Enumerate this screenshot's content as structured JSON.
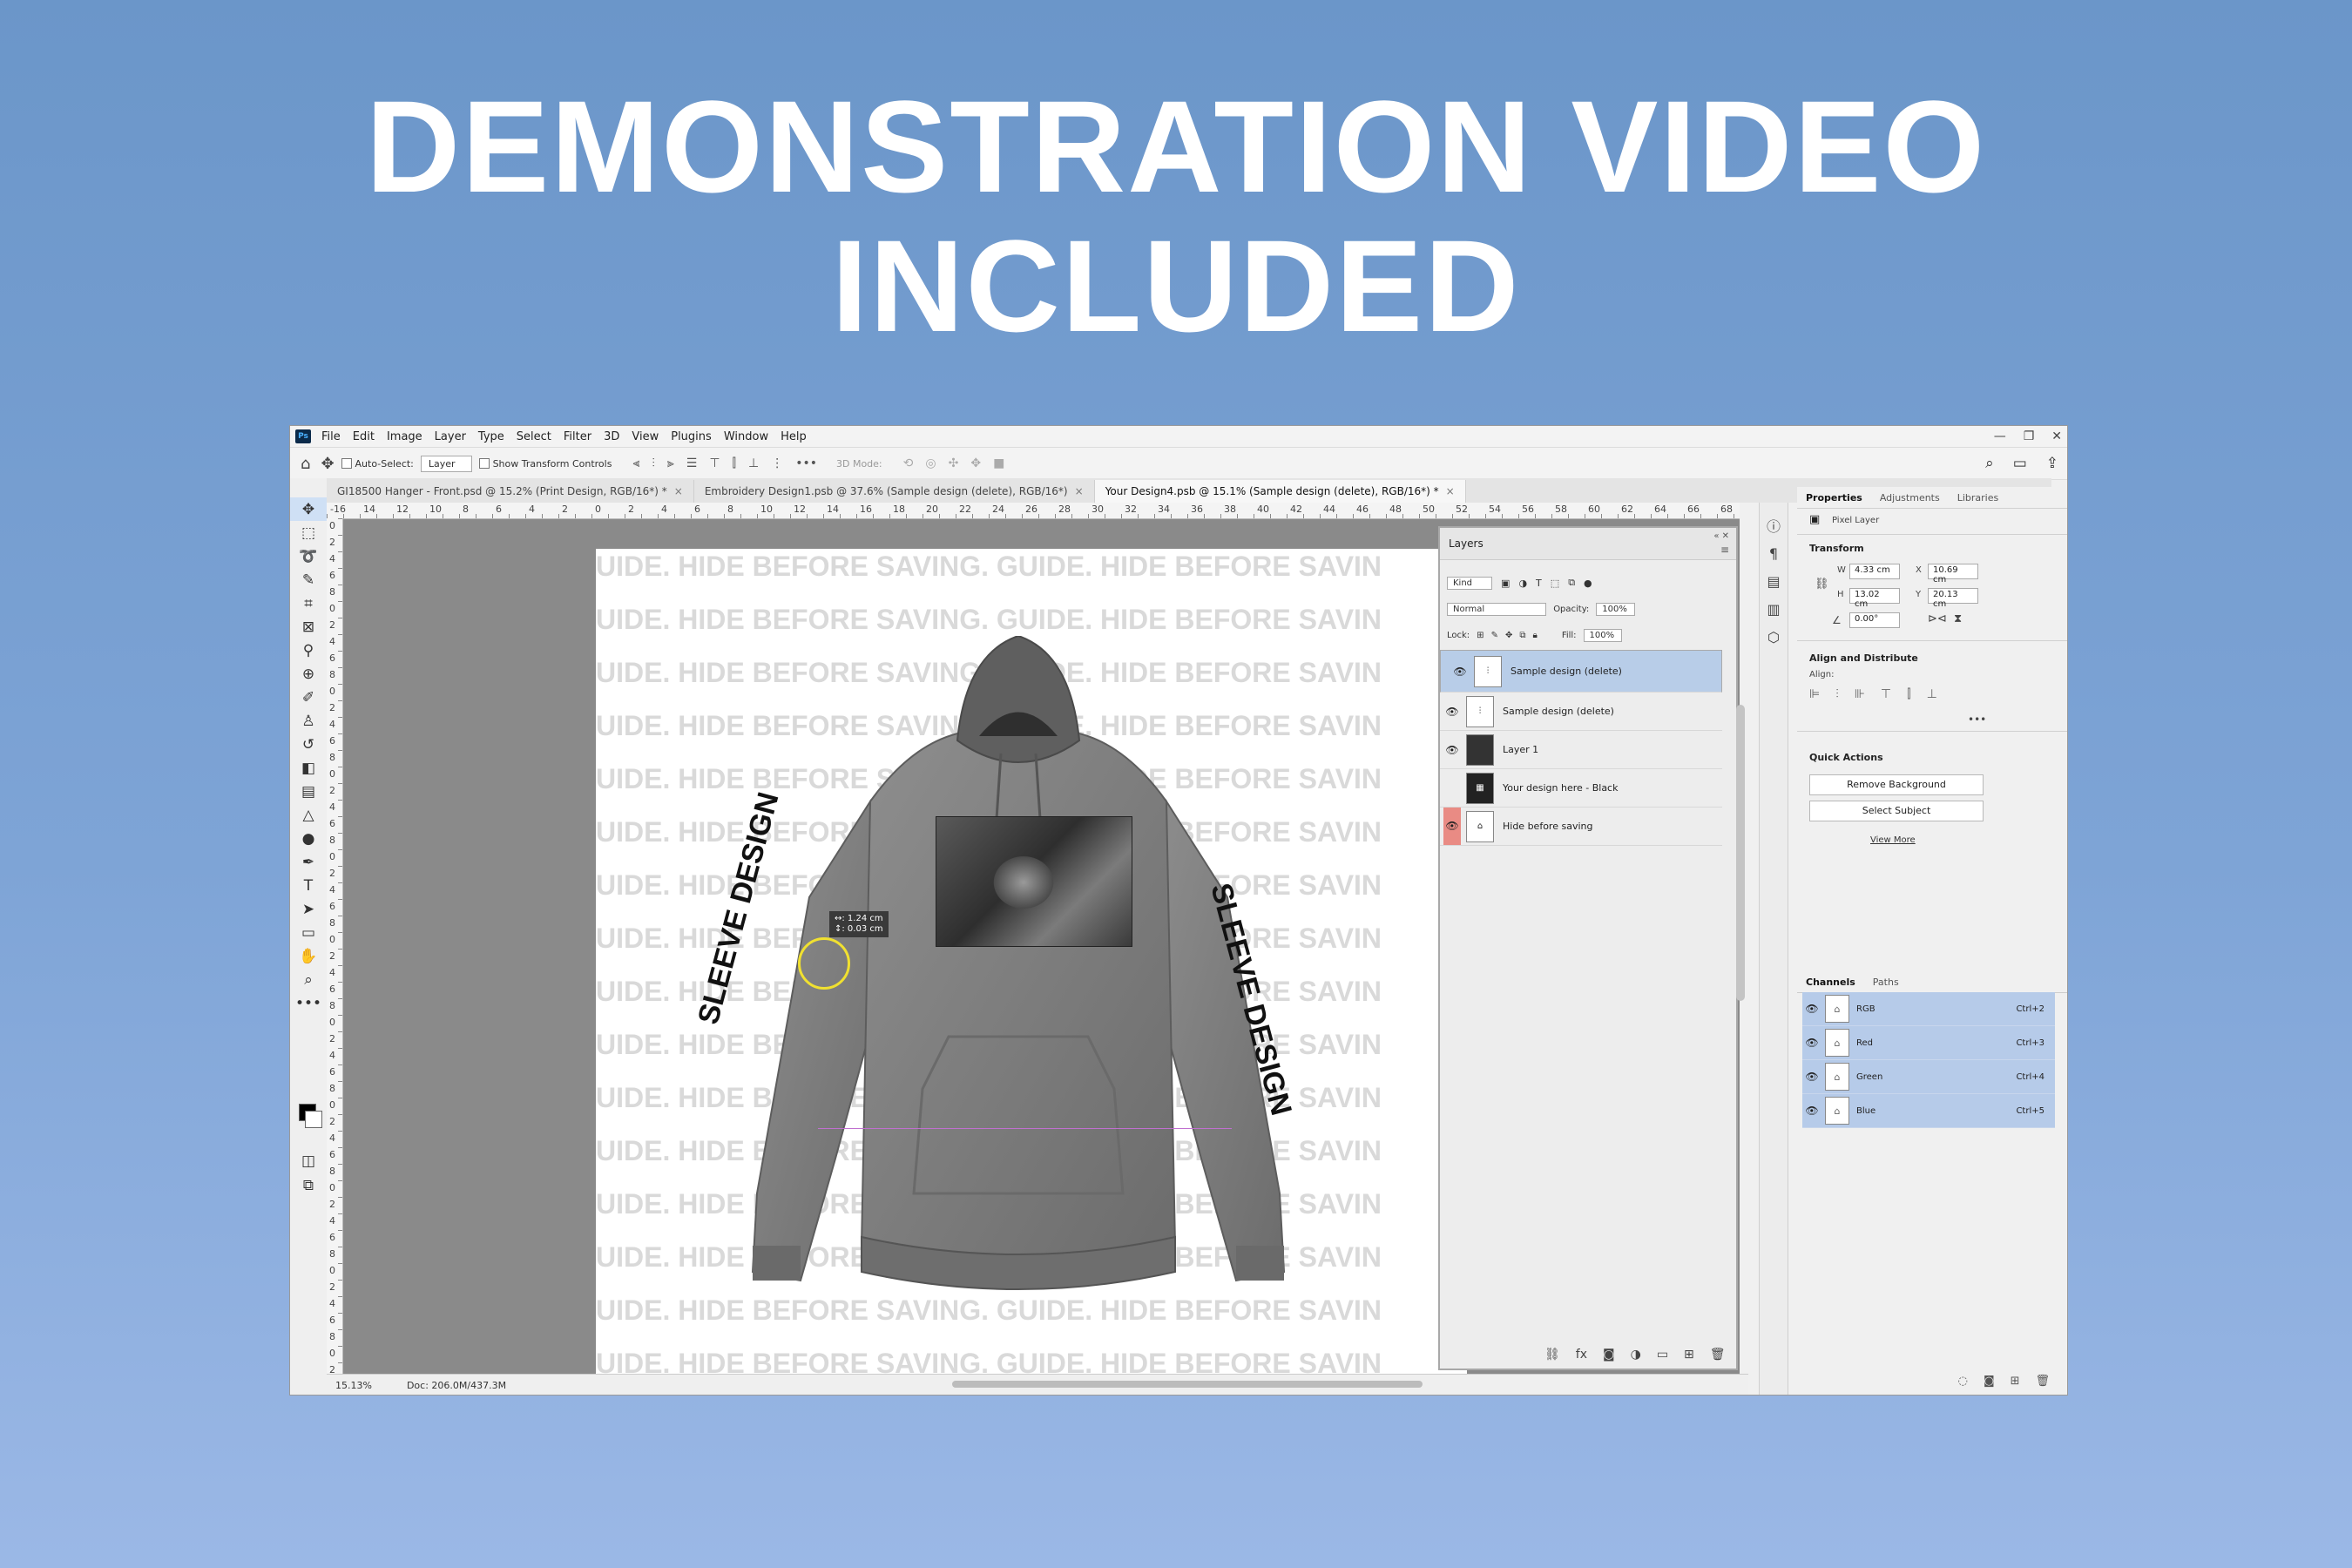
{
  "headline": {
    "line1": "DEMONSTRATION VIDEO",
    "line2": "INCLUDED"
  },
  "app": {
    "logo": "Ps",
    "menus": [
      "File",
      "Edit",
      "Image",
      "Layer",
      "Type",
      "Select",
      "Filter",
      "3D",
      "View",
      "Plugins",
      "Window",
      "Help"
    ],
    "window_controls": [
      "—",
      "❐",
      "✕"
    ]
  },
  "options_bar": {
    "auto_select_label": "Auto-Select:",
    "auto_select_value": "Layer",
    "transform_controls_label": "Show Transform Controls",
    "mode_3d_label": "3D Mode:"
  },
  "tabs": [
    {
      "label": "GI18500 Hanger - Front.psd @ 15.2% (Print Design, RGB/16*) *",
      "active": false
    },
    {
      "label": "Embroidery Design1.psb @ 37.6% (Sample design (delete), RGB/16*)",
      "active": false
    },
    {
      "label": "Your Design4.psb @ 15.1% (Sample design (delete), RGB/16*) *",
      "active": true
    }
  ],
  "ruler_top": [
    "-16",
    "14",
    "12",
    "10",
    "8",
    "6",
    "4",
    "2",
    "0",
    "2",
    "4",
    "6",
    "8",
    "10",
    "12",
    "14",
    "16",
    "18",
    "20",
    "22",
    "24",
    "26",
    "28",
    "30",
    "32",
    "34",
    "36",
    "38",
    "40",
    "42",
    "44",
    "46",
    "48",
    "50",
    "52",
    "54",
    "56",
    "58",
    "60",
    "62",
    "64",
    "66",
    "68"
  ],
  "ruler_left": [
    "0",
    "2",
    "4",
    "6",
    "8",
    "0",
    "2",
    "4",
    "6",
    "8",
    "0",
    "2",
    "4",
    "6",
    "8",
    "0",
    "2",
    "4",
    "6",
    "8",
    "0",
    "2",
    "4",
    "6",
    "8",
    "0",
    "2",
    "4",
    "6",
    "8",
    "0",
    "2",
    "4",
    "6",
    "8",
    "0",
    "2",
    "4",
    "6",
    "8",
    "0",
    "2",
    "4",
    "6",
    "8",
    "0",
    "2",
    "4",
    "6",
    "8",
    "0",
    "2"
  ],
  "canvas": {
    "guide_text": "UIDE. HIDE BEFORE SAVING. GUIDE. HIDE BEFORE SAVIN",
    "sleeve_left": "SLEEVE DESIGN",
    "sleeve_right": "SLEEVE DESIGN",
    "measure_w": "↔:  1.24 cm",
    "measure_h": "↕:  0.03 cm"
  },
  "status": {
    "zoom": "15.13%",
    "doc": "Doc: 206.0M/437.3M"
  },
  "layers_panel": {
    "title": "Layers",
    "filter_kind": "Kind",
    "blend_mode": "Normal",
    "opacity_label": "Opacity:",
    "opacity_value": "100%",
    "lock_label": "Lock:",
    "fill_label": "Fill:",
    "fill_value": "100%",
    "layers": [
      {
        "name": "Sample design (delete)",
        "selected": true,
        "visible": true,
        "highlight": false
      },
      {
        "name": "Sample design (delete)",
        "selected": false,
        "visible": true,
        "highlight": false
      },
      {
        "name": "Layer 1",
        "selected": false,
        "visible": true,
        "highlight": false
      },
      {
        "name": "Your design here - Black",
        "selected": false,
        "visible": false,
        "highlight": false
      },
      {
        "name": "Hide before saving",
        "selected": false,
        "visible": true,
        "highlight": true
      }
    ]
  },
  "properties": {
    "tabs": [
      "Properties",
      "Adjustments",
      "Libraries"
    ],
    "layer_type": "Pixel Layer",
    "transform_label": "Transform",
    "w_label": "W",
    "w_value": "4.33 cm",
    "h_label": "H",
    "h_value": "13.02 cm",
    "x_label": "X",
    "x_value": "10.69 cm",
    "y_label": "Y",
    "y_value": "20.13 cm",
    "angle_value": "0.00°",
    "align_label": "Align and Distribute",
    "align_sub": "Align:",
    "quick_actions_label": "Quick Actions",
    "remove_bg": "Remove Background",
    "select_subject": "Select Subject",
    "view_more": "View More"
  },
  "channels": {
    "tabs": [
      "Channels",
      "Paths"
    ],
    "rows": [
      {
        "name": "RGB",
        "key": "Ctrl+2"
      },
      {
        "name": "Red",
        "key": "Ctrl+3"
      },
      {
        "name": "Green",
        "key": "Ctrl+4"
      },
      {
        "name": "Blue",
        "key": "Ctrl+5"
      }
    ]
  }
}
